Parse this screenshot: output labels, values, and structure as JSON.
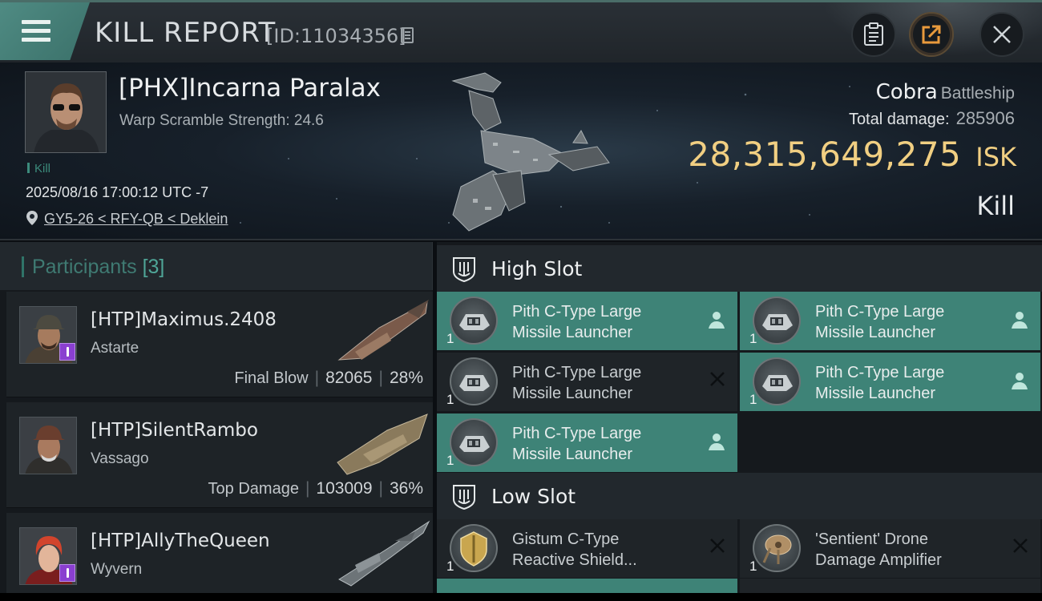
{
  "header": {
    "title": "KILL REPORT",
    "report_id": "[ID:11034356]"
  },
  "victim": {
    "name": "[PHX]Incarna Paralax",
    "warp_scramble": "Warp Scramble Strength: 24.6",
    "tag": "Kill",
    "datetime": "2025/08/16 17:00:12 UTC -7",
    "location": "GY5-26 < RFY-QB < Deklein",
    "ship_name": "Cobra",
    "ship_class": "Battleship",
    "total_damage_label": "Total damage:",
    "total_damage": "285906",
    "isk_value": "28,315,649,275",
    "isk_unit": "ISK",
    "result": "Kill"
  },
  "participants": {
    "title": "Participants",
    "count": "[3]",
    "rows": [
      {
        "name": "[HTP]Maximus.2408",
        "ship": "Astarte",
        "label": "Final Blow",
        "damage": "82065",
        "percent": "28%"
      },
      {
        "name": "[HTP]SilentRambo",
        "ship": "Vassago",
        "label": "Top Damage",
        "damage": "103009",
        "percent": "36%"
      },
      {
        "name": "[HTP]AllyTheQueen",
        "ship": "Wyvern",
        "label": "",
        "damage": "",
        "percent": ""
      }
    ]
  },
  "fitting": {
    "high_slot": {
      "title": "High Slot",
      "items": [
        {
          "qty": "1",
          "line1": "Pith C-Type Large",
          "line2": "Missile Launcher",
          "status": "dropped"
        },
        {
          "qty": "1",
          "line1": "Pith C-Type Large",
          "line2": "Missile Launcher",
          "status": "dropped"
        },
        {
          "qty": "1",
          "line1": "Pith C-Type Large",
          "line2": "Missile Launcher",
          "status": "destroyed"
        },
        {
          "qty": "1",
          "line1": "Pith C-Type Large",
          "line2": "Missile Launcher",
          "status": "dropped"
        },
        {
          "qty": "1",
          "line1": "Pith C-Type Large",
          "line2": "Missile Launcher",
          "status": "dropped"
        }
      ]
    },
    "low_slot": {
      "title": "Low Slot",
      "items": [
        {
          "qty": "1",
          "line1": "Gistum C-Type",
          "line2": "Reactive Shield...",
          "status": "destroyed"
        },
        {
          "qty": "1",
          "line1": "'Sentient' Drone",
          "line2": "Damage Amplifier",
          "status": "destroyed"
        }
      ]
    }
  },
  "colors": {
    "accent_teal": "#3e8377",
    "isk_gold": "#f1cf82",
    "implant_badge": "#8a3fd0"
  },
  "icons": [
    "menu-icon",
    "copy-icon",
    "clipboard-icon",
    "share-icon",
    "close-icon",
    "location-pin-icon",
    "slot-icon",
    "pilot-icon",
    "destroyed-x-icon"
  ]
}
